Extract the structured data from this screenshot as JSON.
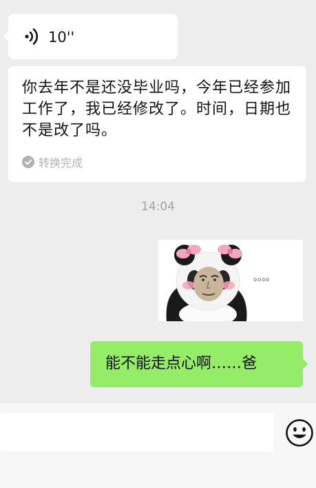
{
  "voice_message": {
    "icon": "voice-icon",
    "duration": "10''"
  },
  "transcription": {
    "text": "你去年不是还没毕业吗，今年已经参加工作了，我已经修改了。时间，日期也不是改了吗。",
    "status_icon": "check-circle-icon",
    "status": "转换完成"
  },
  "timestamp": "14:04",
  "sticker": {
    "caption_dots": "。。。。"
  },
  "outgoing_message": {
    "text": "能不能走点心啊……爸"
  },
  "input_bar": {
    "value": "",
    "emoji_icon": "emoji-icon"
  },
  "colors": {
    "background": "#ededed",
    "incoming_bubble": "#ffffff",
    "outgoing_bubble": "#95ec69",
    "muted_text": "#b2b2b2"
  }
}
